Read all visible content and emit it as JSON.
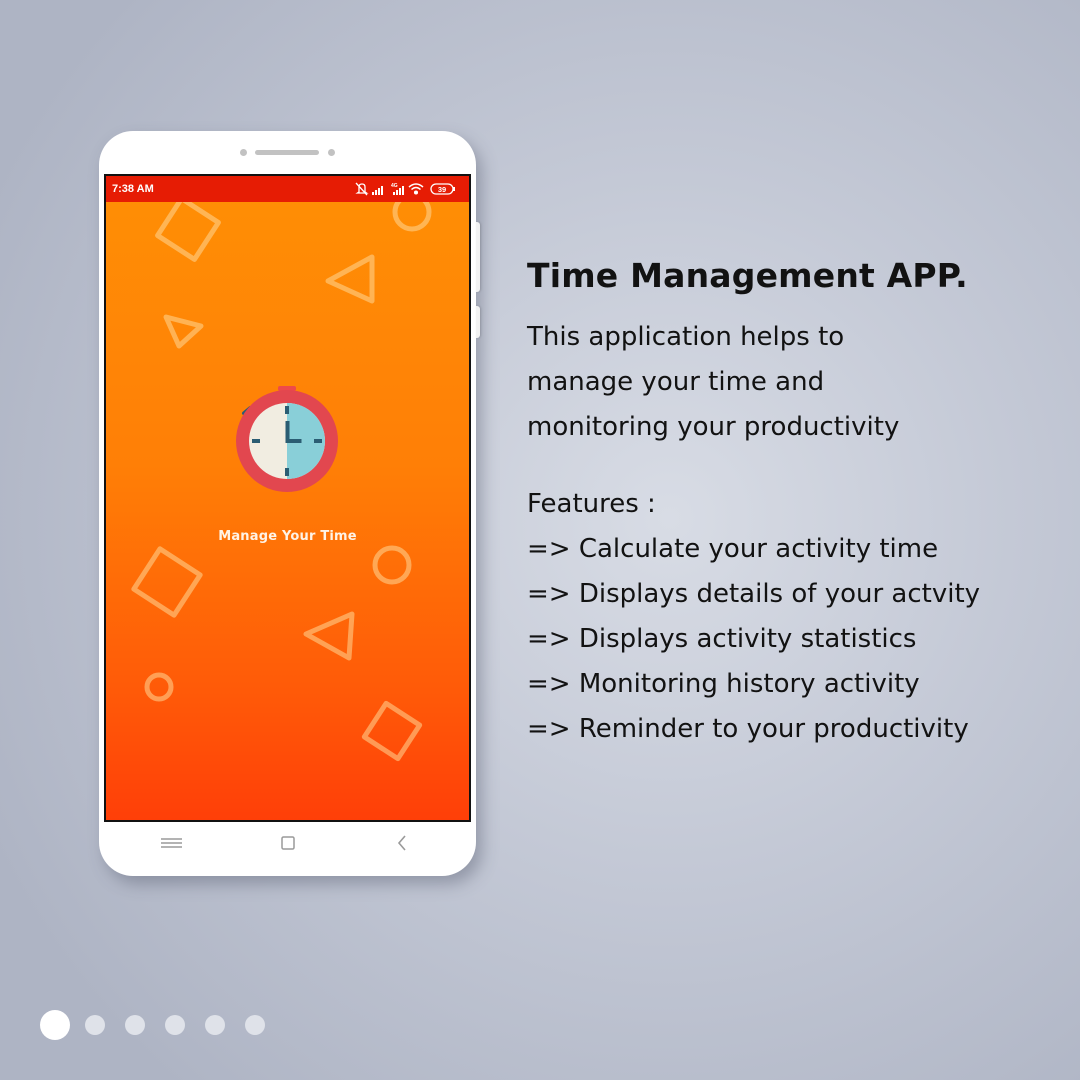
{
  "phone": {
    "status_bar": {
      "time": "7:38 AM",
      "icons": [
        "bell-muted-icon",
        "signal-icon",
        "4g-signal-icon",
        "wifi-icon",
        "battery-icon"
      ],
      "battery_level": "39",
      "color": "#e61c04"
    },
    "app": {
      "tagline": "Manage Your Time",
      "gradient_top": "#ff8f05",
      "gradient_bottom": "#ff3f08",
      "logo_icon": "stopwatch-icon",
      "decoration_icons": [
        "diamond-outline",
        "circle-outline",
        "triangle-outline"
      ]
    },
    "nav_bar": {
      "icons": [
        "menu-icon",
        "home-square-icon",
        "back-chevron-icon"
      ]
    }
  },
  "content": {
    "title": "Time Management APP.",
    "description": "This application helps to\nmanage your time and\nmonitoring your productivity",
    "features_heading": "Features :",
    "features": [
      "=> Calculate your activity time",
      "=> Displays details of your actvity",
      "=> Displays activity statistics",
      "=> Monitoring history activity",
      "=> Reminder to your productivity"
    ]
  },
  "pagination": {
    "total": 6,
    "active_index": 0,
    "active_color": "#ffffff",
    "inactive_color": "#dfe2e9"
  }
}
